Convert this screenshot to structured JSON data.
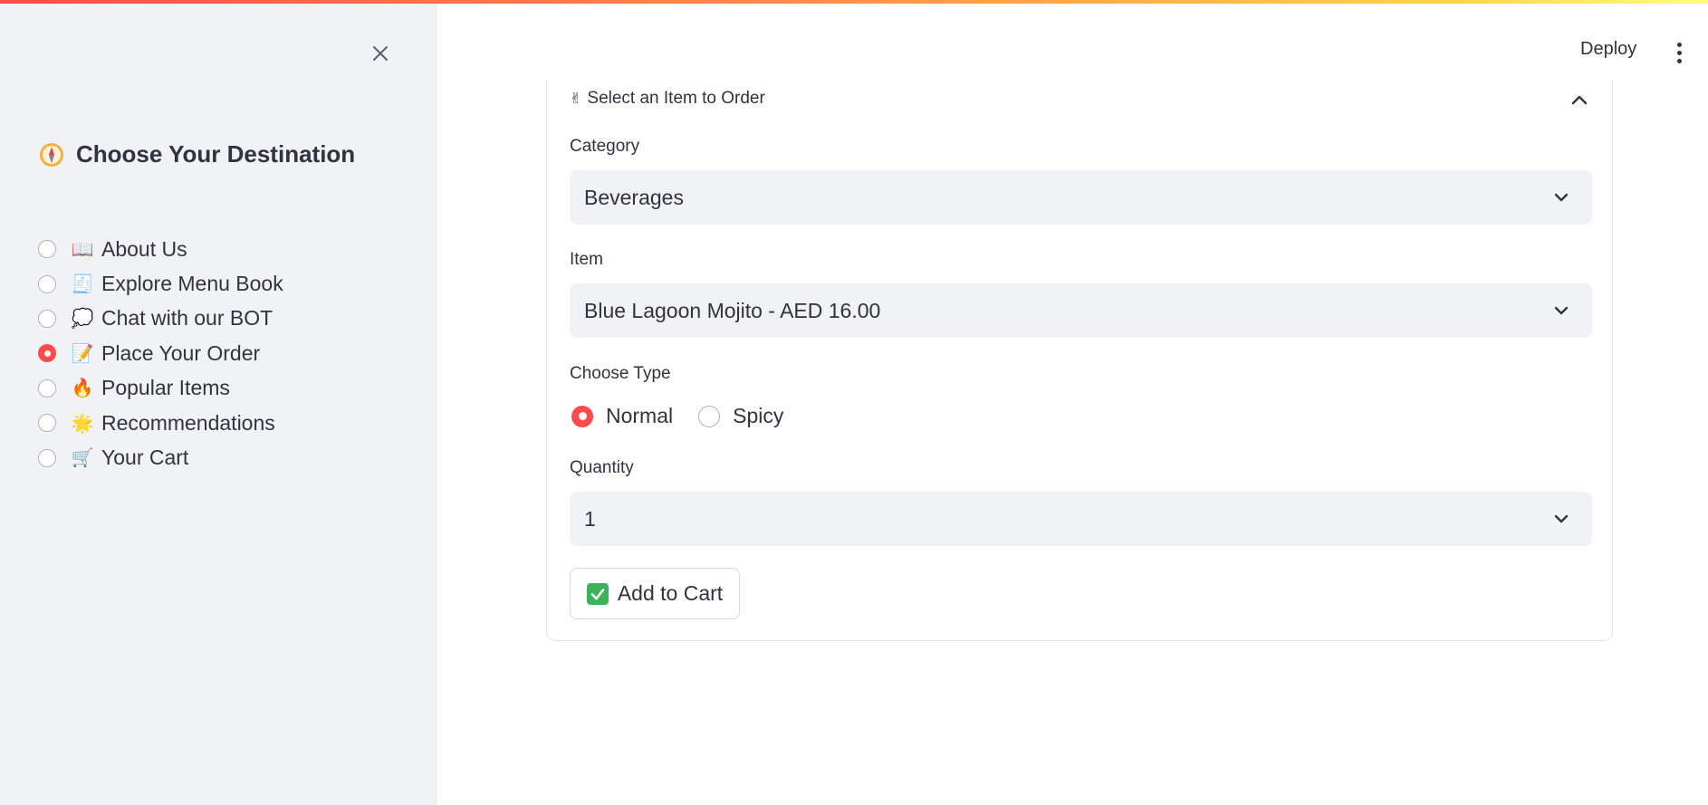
{
  "header": {
    "deploy_label": "Deploy"
  },
  "sidebar": {
    "title": "Choose Your Destination",
    "items": [
      {
        "emoji": "📖",
        "label": "About Us",
        "selected": false
      },
      {
        "emoji": "🧾",
        "label": "Explore Menu Book",
        "selected": false
      },
      {
        "emoji": "💭",
        "label": "Chat with our BOT",
        "selected": false
      },
      {
        "emoji": "📝",
        "label": "Place Your Order",
        "selected": true
      },
      {
        "emoji": "🔥",
        "label": "Popular Items",
        "selected": false
      },
      {
        "emoji": "🌟",
        "label": "Recommendations",
        "selected": false
      },
      {
        "emoji": "🛒",
        "label": "Your Cart",
        "selected": false
      }
    ]
  },
  "order": {
    "expander_title": "Select an Item to Order",
    "expander_emoji": "✌",
    "category": {
      "label": "Category",
      "value": "Beverages"
    },
    "item": {
      "label": "Item",
      "value": "Blue Lagoon Mojito - AED 16.00"
    },
    "type": {
      "label": "Choose Type",
      "options": [
        {
          "label": "Normal",
          "selected": true
        },
        {
          "label": "Spicy",
          "selected": false
        }
      ]
    },
    "quantity": {
      "label": "Quantity",
      "value": "1"
    },
    "add_to_cart_label": "Add to Cart"
  },
  "colors": {
    "accent": "#ff4b4b",
    "sidebar_bg": "#f0f2f6",
    "text": "#31333f"
  }
}
